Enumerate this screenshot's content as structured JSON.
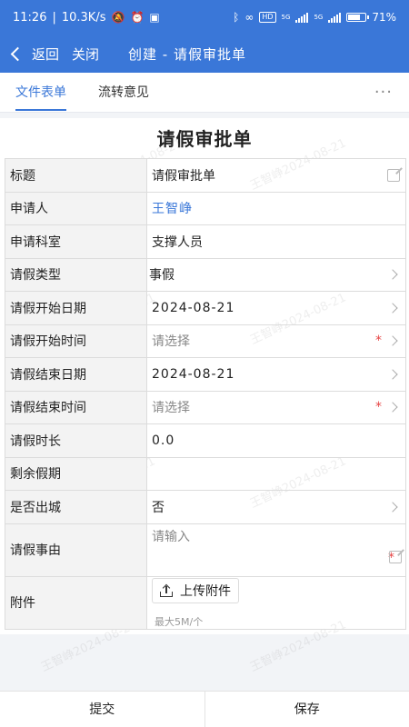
{
  "status_bar": {
    "time": "11:26",
    "network_speed": "10.3K/s",
    "hd_badge": "HD",
    "sig1_label": "5G",
    "sig2_label": "5G",
    "battery_percent": 71,
    "battery_text": "71%"
  },
  "nav": {
    "back_label": "返回",
    "close_label": "关闭",
    "title": "创建 - 请假审批单"
  },
  "tabs": [
    {
      "label": "文件表单"
    },
    {
      "label": "流转意见"
    }
  ],
  "more_label": "···",
  "sheet": {
    "title": "请假审批单",
    "watermark": "王智峥2024-08-21"
  },
  "form": {
    "title": {
      "label": "标题",
      "value": "请假审批单"
    },
    "applicant": {
      "label": "申请人",
      "value": "王智峥"
    },
    "department": {
      "label": "申请科室",
      "value": "支撑人员"
    },
    "leave_type": {
      "label": "请假类型",
      "value": "事假"
    },
    "start_date": {
      "label": "请假开始日期",
      "value": "2024-08-21"
    },
    "start_time": {
      "label": "请假开始时间",
      "placeholder": "请选择"
    },
    "end_date": {
      "label": "请假结束日期",
      "value": "2024-08-21"
    },
    "end_time": {
      "label": "请假结束时间",
      "placeholder": "请选择"
    },
    "duration": {
      "label": "请假时长",
      "value": "0.0"
    },
    "remaining": {
      "label": "剩余假期",
      "value": ""
    },
    "out_of_city": {
      "label": "是否出城",
      "value": "否"
    },
    "reason": {
      "label": "请假事由",
      "placeholder": "请输入"
    },
    "attachment": {
      "label": "附件",
      "button": "上传附件",
      "hint": "最大5M/个"
    }
  },
  "required_mark": "*",
  "footer": {
    "submit": "提交",
    "save": "保存"
  },
  "colors": {
    "primary": "#3a77d8",
    "required": "#e64545"
  }
}
